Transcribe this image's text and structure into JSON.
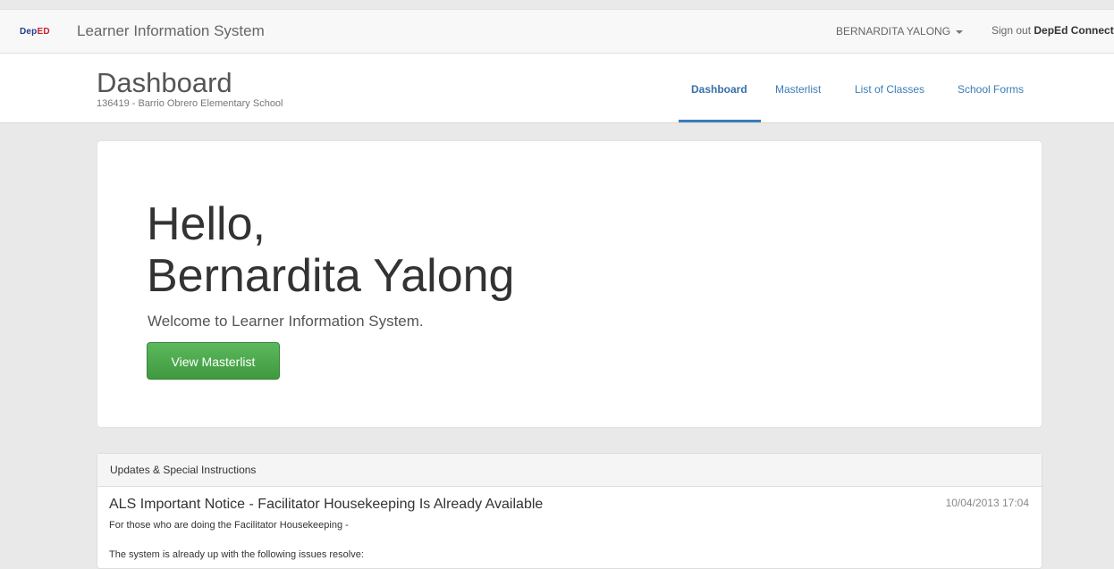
{
  "topbar": {
    "logo": {
      "part1": "Dep",
      "part2": "ED"
    },
    "brand": "Learner Information System",
    "user_name": "BERNARDITA YALONG",
    "signout_prefix": "Sign out",
    "signout_bold": "DepEd Connect"
  },
  "header": {
    "title": "Dashboard",
    "subtitle": "136419 - Barrio Obrero Elementary School",
    "nav": [
      {
        "label": "Dashboard",
        "active": true
      },
      {
        "label": "Masterlist",
        "active": false
      },
      {
        "label": "List of Classes",
        "active": false
      },
      {
        "label": "School Forms",
        "active": false
      }
    ]
  },
  "hero": {
    "greeting_line1": "Hello,",
    "greeting_line2": "Bernardita Yalong",
    "welcome": "Welcome to Learner Information System.",
    "button_label": "View Masterlist"
  },
  "updates": {
    "heading": "Updates & Special Instructions",
    "notices": [
      {
        "title": "ALS Important Notice - Facilitator Housekeeping Is Already Available",
        "date": "10/04/2013 17:04",
        "line1": "For those who are doing the Facilitator Housekeeping -",
        "line2": "The system is already up with the following issues resolve:"
      }
    ]
  },
  "colors": {
    "accent": "#3a7cb8",
    "button_green": "#4cae4c",
    "background": "#e9e9e9"
  }
}
